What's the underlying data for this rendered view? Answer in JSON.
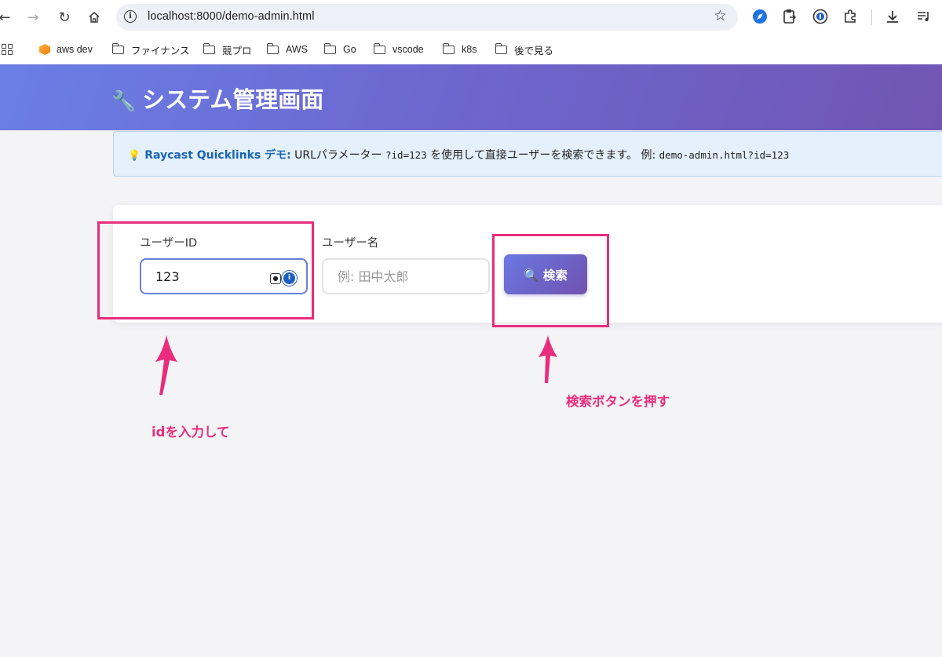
{
  "browser": {
    "url": "localhost:8000/demo-admin.html",
    "bookmarks": [
      {
        "label": "aws dev",
        "icon": "aws-cube-icon"
      },
      {
        "label": "ファイナンス",
        "icon": "folder-icon"
      },
      {
        "label": "競プロ",
        "icon": "folder-icon"
      },
      {
        "label": "AWS",
        "icon": "folder-icon"
      },
      {
        "label": "Go",
        "icon": "folder-icon"
      },
      {
        "label": "vscode",
        "icon": "folder-icon"
      },
      {
        "label": "k8s",
        "icon": "folder-icon"
      },
      {
        "label": "後で見る",
        "icon": "folder-icon"
      }
    ]
  },
  "header": {
    "icon": "wrench-icon",
    "title": "システム管理画面"
  },
  "info": {
    "brand": "Raycast Quicklinks デモ:",
    "text_before": "URLパラメーター",
    "param": "?id=123",
    "text_after": "を使用して直接ユーザーを検索できます。 例:",
    "example": "demo-admin.html?id=123"
  },
  "form": {
    "user_id_label": "ユーザーID",
    "user_id_value": "123",
    "user_name_label": "ユーザー名",
    "user_name_placeholder": "例: 田中太郎",
    "search_button": "🔍 検索"
  },
  "annotations": {
    "input_note": "idを入力して",
    "button_note": "検索ボタンを押す",
    "color": "#ea2c7d"
  },
  "colors": {
    "header_start": "#6a7fe6",
    "header_end": "#7155b3",
    "brand_text": "#1a64b4"
  }
}
